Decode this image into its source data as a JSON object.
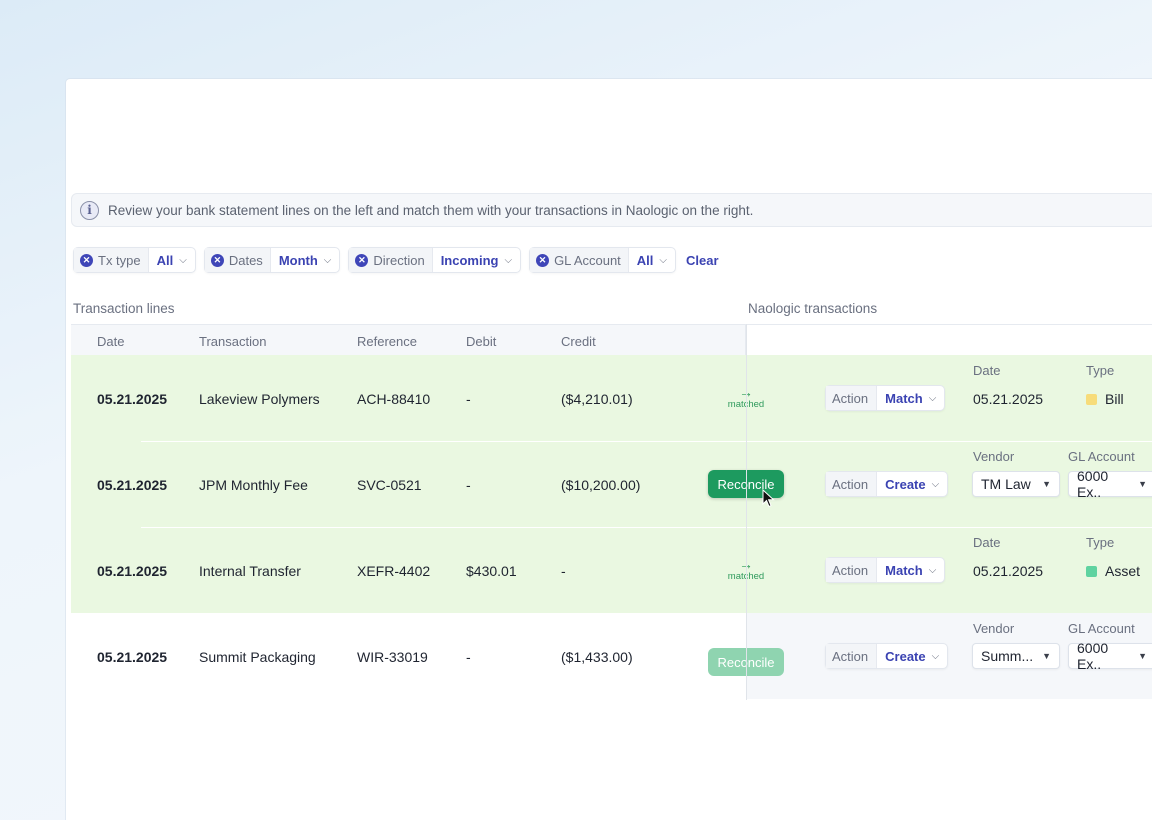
{
  "info": {
    "icon": "info-icon",
    "text": "Review your bank statement lines on the left and match them with your transactions in Naologic on the right."
  },
  "filters": [
    {
      "label": "Tx type",
      "value": "All"
    },
    {
      "label": "Dates",
      "value": "Month"
    },
    {
      "label": "Direction",
      "value": "Incoming"
    },
    {
      "label": "GL Account",
      "value": "All"
    }
  ],
  "clear_label": "Clear",
  "sections": {
    "left_title": "Transaction lines",
    "right_title": "Naologic transactions"
  },
  "columns": [
    "Date",
    "Transaction",
    "Reference",
    "Debit",
    "Credit"
  ],
  "rows": [
    {
      "date": "05.21.2025",
      "transaction": "Lakeview Polymers",
      "reference": "ACH-88410",
      "debit": "-",
      "credit": "($4,210.01)",
      "status": "matched",
      "status_label": "matched",
      "action_label": "Action",
      "action_value": "Match",
      "detail_label_1": "Date",
      "detail_value_1": "05.21.2025",
      "detail_label_2": "Type",
      "detail_value_2": "Bill",
      "type_color": "#f7dc7a",
      "highlight": "green"
    },
    {
      "date": "05.21.2025",
      "transaction": "JPM Monthly Fee",
      "reference": "SVC-0521",
      "debit": "-",
      "credit": "($10,200.00)",
      "status": "reconcile",
      "status_label": "Reconcile",
      "action_label": "Action",
      "action_value": "Create",
      "detail_label_1": "Vendor",
      "detail_value_1": "TM Law",
      "detail_label_2": "GL Account",
      "detail_value_2": "6000 Ex..",
      "highlight": "green"
    },
    {
      "date": "05.21.2025",
      "transaction": "Internal Transfer",
      "reference": "XEFR-4402",
      "debit": "$430.01",
      "credit": "-",
      "status": "matched",
      "status_label": "matched",
      "action_label": "Action",
      "action_value": "Match",
      "detail_label_1": "Date",
      "detail_value_1": "05.21.2025",
      "detail_label_2": "Type",
      "detail_value_2": "Asset",
      "type_color": "#5fd3a0",
      "highlight": "green"
    },
    {
      "date": "05.21.2025",
      "transaction": "Summit Packaging",
      "reference": "WIR-33019",
      "debit": "-",
      "credit": "($1,433.00)",
      "status": "reconcile-disabled",
      "status_label": "Reconcile",
      "action_label": "Action",
      "action_value": "Create",
      "detail_label_1": "Vendor",
      "detail_value_1": "Summ...",
      "detail_label_2": "GL Account",
      "detail_value_2": "6000 Ex..",
      "highlight": "none"
    }
  ],
  "colors": {
    "accent": "#3b43b2",
    "row_highlight": "#eaf8e1",
    "reconcile_active": "#1d9a5f",
    "reconcile_disabled": "#8fd4b0",
    "matched_text": "#2f9a5c"
  }
}
